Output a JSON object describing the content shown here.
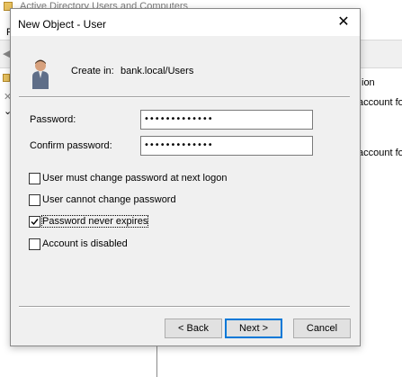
{
  "background_window": {
    "title": "Active Directory Users and Computers",
    "menu_first_letter": "F",
    "right_pane_lines": [
      "ion",
      "account fo",
      "account fo"
    ]
  },
  "dialog": {
    "title": "New Object - User",
    "close_glyph": "✕",
    "create_in_label": "Create in:",
    "create_in_value": "bank.local/Users"
  },
  "form": {
    "password_label": "Password:",
    "password_value": "•••••••••••••",
    "confirm_label": "Confirm password:",
    "confirm_value": "•••••••••••••"
  },
  "options": [
    {
      "label": "User must change password at next logon",
      "checked": false
    },
    {
      "label": "User cannot change password",
      "checked": false
    },
    {
      "label": "Password never expires",
      "checked": true
    },
    {
      "label": "Account is disabled",
      "checked": false
    }
  ],
  "buttons": {
    "back": "< Back",
    "next": "Next >",
    "cancel": "Cancel"
  },
  "icons": [
    "user-icon",
    "close-icon",
    "checkmark-icon",
    "folder-icon"
  ],
  "colors": {
    "dialog_bg": "#f0f0f0",
    "default_button_border": "#0078d7"
  }
}
